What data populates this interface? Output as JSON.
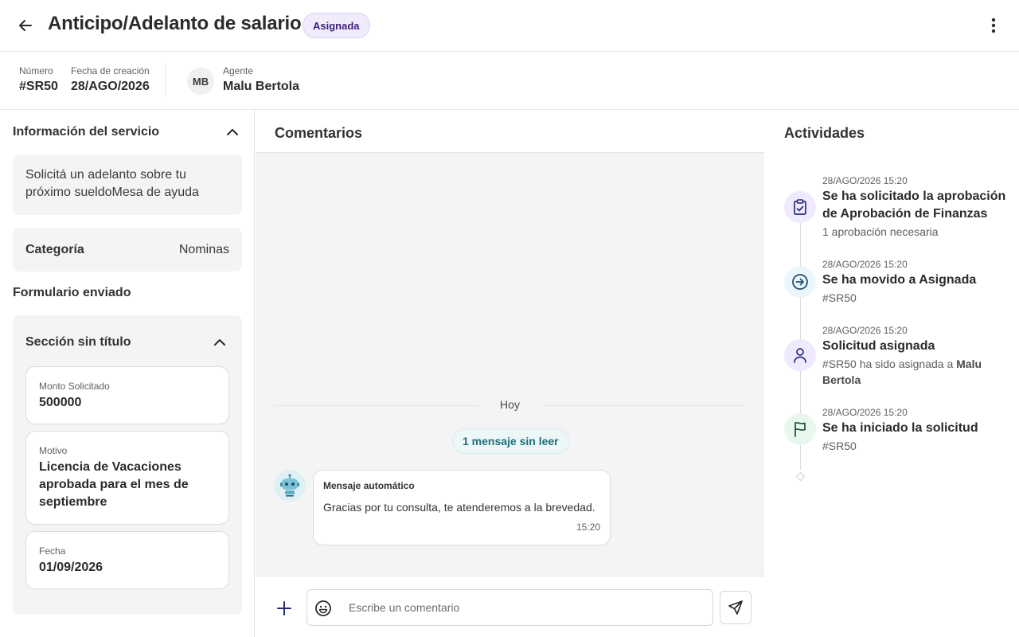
{
  "header": {
    "title": "Anticipo/Adelanto de salario",
    "status": "Asignada"
  },
  "meta": {
    "number_label": "Número",
    "number_value": "#SR50",
    "created_label": "Fecha de creación",
    "created_value": "28/AGO/2026",
    "agent_initials": "MB",
    "agent_label": "Agente",
    "agent_name": "Malu Bertola"
  },
  "service": {
    "section_title": "Información del servicio",
    "description": "Solicitá un adelanto sobre tu próximo sueldoMesa de ayuda",
    "category_label": "Categoría",
    "category_value": "Nominas",
    "form_title": "Formulario enviado",
    "form_section_title": "Sección sin título",
    "fields": [
      {
        "label": "Monto Solicitado",
        "value": "500000"
      },
      {
        "label": "Motivo",
        "value": "Licencia de Vacaciones aprobada para el mes de septiembre"
      },
      {
        "label": "Fecha",
        "value": "01/09/2026"
      }
    ]
  },
  "comments": {
    "title": "Comentarios",
    "day_separator": "Hoy",
    "unread": "1 mensaje sin leer",
    "message": {
      "author": "Mensaje automático",
      "text": "Gracias por tu consulta, te atenderemos a la brevedad.",
      "time": "15:20"
    },
    "placeholder": "Escribe un comentario"
  },
  "activities": {
    "title": "Actividades",
    "items": [
      {
        "icon": "clipboard-check-icon",
        "timestamp": "28/AGO/2026 15:20",
        "title": "Se ha solicitado la aprobación de Aprobación de Finanzas",
        "detail": "1 aprobación necesaria"
      },
      {
        "icon": "arrow-right-circle-icon",
        "timestamp": "28/AGO/2026 15:20",
        "title": "Se ha movido a Asignada",
        "detail": "#SR50"
      },
      {
        "icon": "user-icon",
        "timestamp": "28/AGO/2026 15:20",
        "title": "Solicitud asignada",
        "detail_prefix": "#SR50 ha sido asignada a ",
        "detail_bold": "Malu Bertola"
      },
      {
        "icon": "flag-icon",
        "timestamp": "28/AGO/2026 15:20",
        "title": "Se ha iniciado la solicitud",
        "detail": "#SR50"
      }
    ]
  },
  "colors": {
    "badge_bg": "#f1ecfc",
    "badge_text": "#3b1f7a",
    "accent_navy": "#2a2a7a",
    "unread_text": "#1f6e7a",
    "panel_bg": "#f4f4f4"
  }
}
